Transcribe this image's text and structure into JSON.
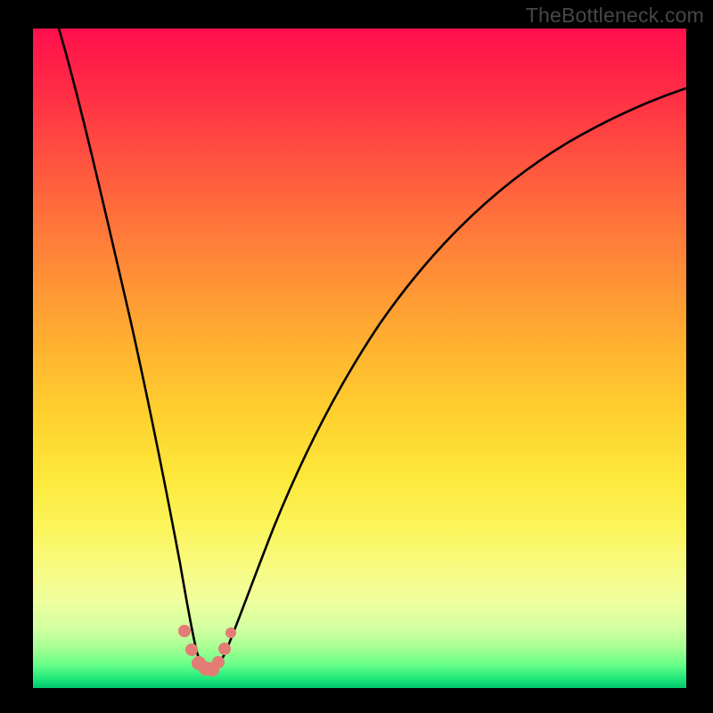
{
  "watermark": "TheBottleneck.com",
  "chart_data": {
    "type": "line",
    "title": "",
    "xlabel": "",
    "ylabel": "",
    "xlim": [
      0,
      100
    ],
    "ylim": [
      0,
      100
    ],
    "grid": false,
    "legend": false,
    "series": [
      {
        "name": "bottleneck-curve",
        "color": "#000000",
        "x": [
          4,
          6,
          8,
          10,
          12,
          14,
          16,
          18,
          20,
          22,
          23,
          24,
          25,
          26,
          27,
          28,
          29,
          30,
          32,
          34,
          36,
          38,
          40,
          44,
          48,
          52,
          56,
          60,
          66,
          72,
          80,
          90,
          100
        ],
        "values": [
          100,
          94,
          87,
          80,
          72,
          64,
          55,
          46,
          36,
          24,
          17,
          10,
          5,
          3,
          2.5,
          3,
          4,
          6,
          12,
          19,
          26,
          32,
          37,
          46,
          53,
          59,
          64,
          68,
          73,
          77,
          81,
          85,
          88
        ]
      },
      {
        "name": "bottleneck-markers",
        "color": "#e37c75",
        "marker": "circle",
        "x": [
          22.5,
          24.0,
          25.0,
          25.7,
          26.5,
          27.2,
          28.0,
          28.8,
          29.5
        ],
        "values": [
          8,
          4,
          3,
          2.8,
          2.8,
          3.2,
          4.5,
          6.5,
          9
        ]
      }
    ],
    "background_gradient": {
      "top": "#ff0f4c",
      "bottom": "#00c96e"
    }
  }
}
